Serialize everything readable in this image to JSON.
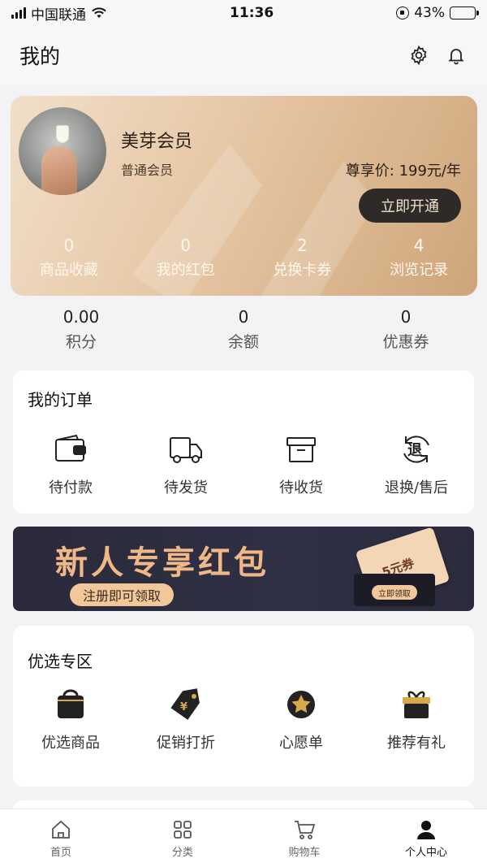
{
  "status_bar": {
    "carrier": "中国联通",
    "time": "11:36",
    "battery": "43%",
    "battery_level": 0.43
  },
  "header": {
    "title": "我的",
    "settings_icon": "gear-icon",
    "bell_icon": "bell-icon"
  },
  "member": {
    "name": "美芽会员",
    "level": "普通会员",
    "price": "尊享价: 199元/年",
    "open_label": "立即开通",
    "stats": [
      {
        "value": "0",
        "label": "商品收藏"
      },
      {
        "value": "0",
        "label": "我的红包"
      },
      {
        "value": "2",
        "label": "兑换卡券"
      },
      {
        "value": "4",
        "label": "浏览记录"
      }
    ]
  },
  "balances": [
    {
      "value": "0.00",
      "label": "积分"
    },
    {
      "value": "0",
      "label": "余额"
    },
    {
      "value": "0",
      "label": "优惠券"
    }
  ],
  "orders": {
    "title": "我的订单",
    "items": [
      {
        "label": "待付款",
        "icon": "wallet-icon"
      },
      {
        "label": "待发货",
        "icon": "truck-icon"
      },
      {
        "label": "待收货",
        "icon": "box-icon"
      },
      {
        "label": "退换/售后",
        "icon": "refund-icon",
        "icon_text": "退"
      }
    ]
  },
  "banner": {
    "title": "新人专享红包",
    "cta": "注册即可领取",
    "coupon_text": "5元券",
    "get_label": "立即领取"
  },
  "featured": {
    "title": "优选专区",
    "items": [
      {
        "label": "优选商品",
        "icon": "shopping-bag-icon"
      },
      {
        "label": "促销打折",
        "icon": "price-tag-icon"
      },
      {
        "label": "心愿单",
        "icon": "star-icon"
      },
      {
        "label": "推荐有礼",
        "icon": "gift-icon"
      }
    ]
  },
  "nav": [
    {
      "label": "首页",
      "icon": "home-icon"
    },
    {
      "label": "分类",
      "icon": "grid-icon"
    },
    {
      "label": "购物车",
      "icon": "cart-icon"
    },
    {
      "label": "个人中心",
      "icon": "user-icon",
      "active": true
    }
  ]
}
